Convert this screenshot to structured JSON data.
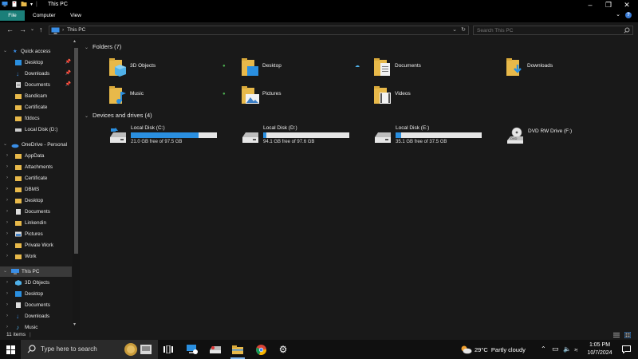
{
  "titlebar": {
    "title": "This PC"
  },
  "ribbon": {
    "tabs": [
      "File",
      "Computer",
      "View"
    ]
  },
  "address": {
    "crumb": "This PC",
    "search_placeholder": "Search This PC"
  },
  "sidebar": {
    "quick_access": "Quick access",
    "quick_items": [
      "Desktop",
      "Downloads",
      "Documents",
      "Bandicam",
      "Certificate",
      "fddocs",
      "Local Disk (D:)"
    ],
    "onedrive": "OneDrive - Personal",
    "onedrive_items": [
      "AppData",
      "Attachments",
      "Certificate",
      "DBMS",
      "Desktop",
      "Documents",
      "Linkendin",
      "Pictures",
      "Private Work",
      "Work"
    ],
    "this_pc": "This PC",
    "this_pc_items": [
      "3D Objects",
      "Desktop",
      "Documents",
      "Downloads",
      "Music"
    ]
  },
  "content": {
    "folders_header": "Folders (7)",
    "folders": [
      "3D Objects",
      "Desktop",
      "Documents",
      "Downloads",
      "Music",
      "Pictures",
      "Videos"
    ],
    "drives_header": "Devices and drives (4)",
    "drives": [
      {
        "name": "Local Disk (C:)",
        "free": "21.0 GB free of 97.5 GB",
        "used_fraction": 0.785
      },
      {
        "name": "Local Disk (D:)",
        "free": "94.1 GB free of 97.6 GB",
        "used_fraction": 0.036
      },
      {
        "name": "Local Disk (E:)",
        "free": "35.1 GB free of 37.5 GB",
        "used_fraction": 0.064
      },
      {
        "name": "DVD RW Drive (F:)"
      }
    ]
  },
  "statusbar": {
    "count": "11 items"
  },
  "taskbar": {
    "search_label": "Type here to search",
    "weather": "29°C  Partly cloudy",
    "time": "1:05 PM",
    "date": "10/7/2024"
  },
  "colors": {
    "accent": "#1b7f79",
    "drive_bar_fill": "#2a8fe0",
    "folder_yellow": "#e8b94a"
  }
}
